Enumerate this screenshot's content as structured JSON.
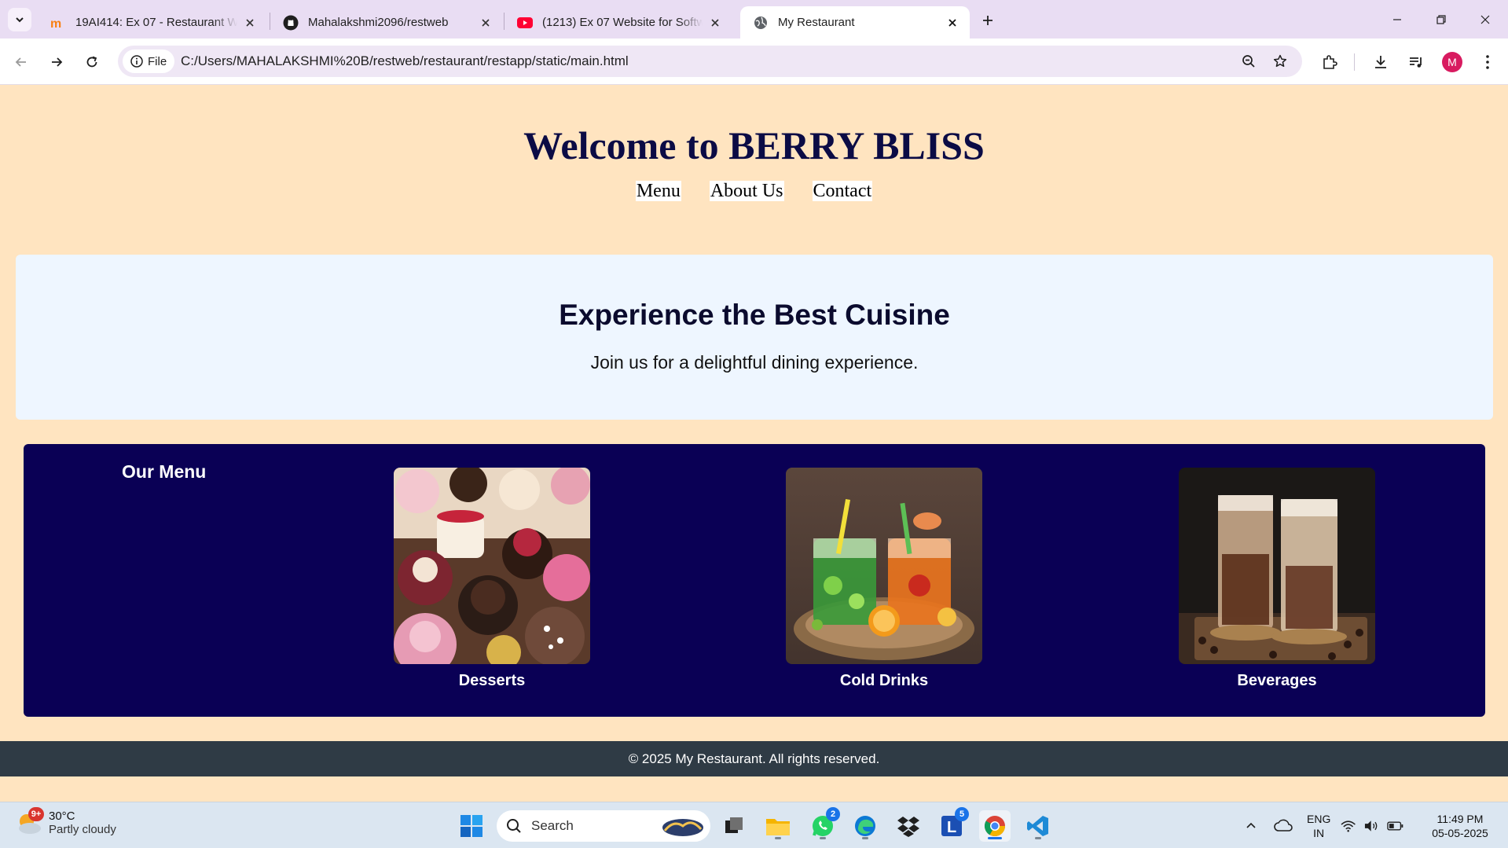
{
  "browser": {
    "tabs": [
      {
        "title": "19AI414: Ex 07 - Restaurant We",
        "icon": "moodle-icon"
      },
      {
        "title": "Mahalakshmi2096/restweb",
        "icon": "github-icon"
      },
      {
        "title": "(1213) Ex 07 Website for Softwa",
        "icon": "youtube-icon"
      },
      {
        "title": "My Restaurant",
        "icon": "globe-icon",
        "active": true
      }
    ],
    "address_chip": "File",
    "url": "C:/Users/MAHALAKSHMI%20B/restweb/restaurant/restapp/static/main.html",
    "profile_initial": "M"
  },
  "page": {
    "title": "Welcome to BERRY BLISS",
    "nav": [
      "Menu",
      "About Us",
      "Contact"
    ],
    "hero": {
      "heading": "Experience the Best Cuisine",
      "subheading": "Join us for a delightful dining experience."
    },
    "menu": {
      "heading": "Our Menu",
      "items": [
        {
          "name": "Desserts",
          "image": "desserts-photo"
        },
        {
          "name": "Cold Drinks",
          "image": "cold-drinks-photo"
        },
        {
          "name": "Beverages",
          "image": "beverages-photo"
        }
      ]
    },
    "footer": "© 2025 My Restaurant. All rights reserved."
  },
  "taskbar": {
    "weather": {
      "temp": "30°C",
      "desc": "Partly cloudy",
      "badge": "9+"
    },
    "search_placeholder": "Search",
    "whatsapp_badge": "2",
    "l_app_badge": "5",
    "language": {
      "line1": "ENG",
      "line2": "IN"
    },
    "time": "11:49 PM",
    "date": "05-05-2025"
  },
  "colors": {
    "page_bg": "#ffe4c0",
    "title": "#0b0b45",
    "hero_bg": "#eef6ff",
    "menu_bg": "#0a0055",
    "footer_bg": "#2f3b45"
  }
}
